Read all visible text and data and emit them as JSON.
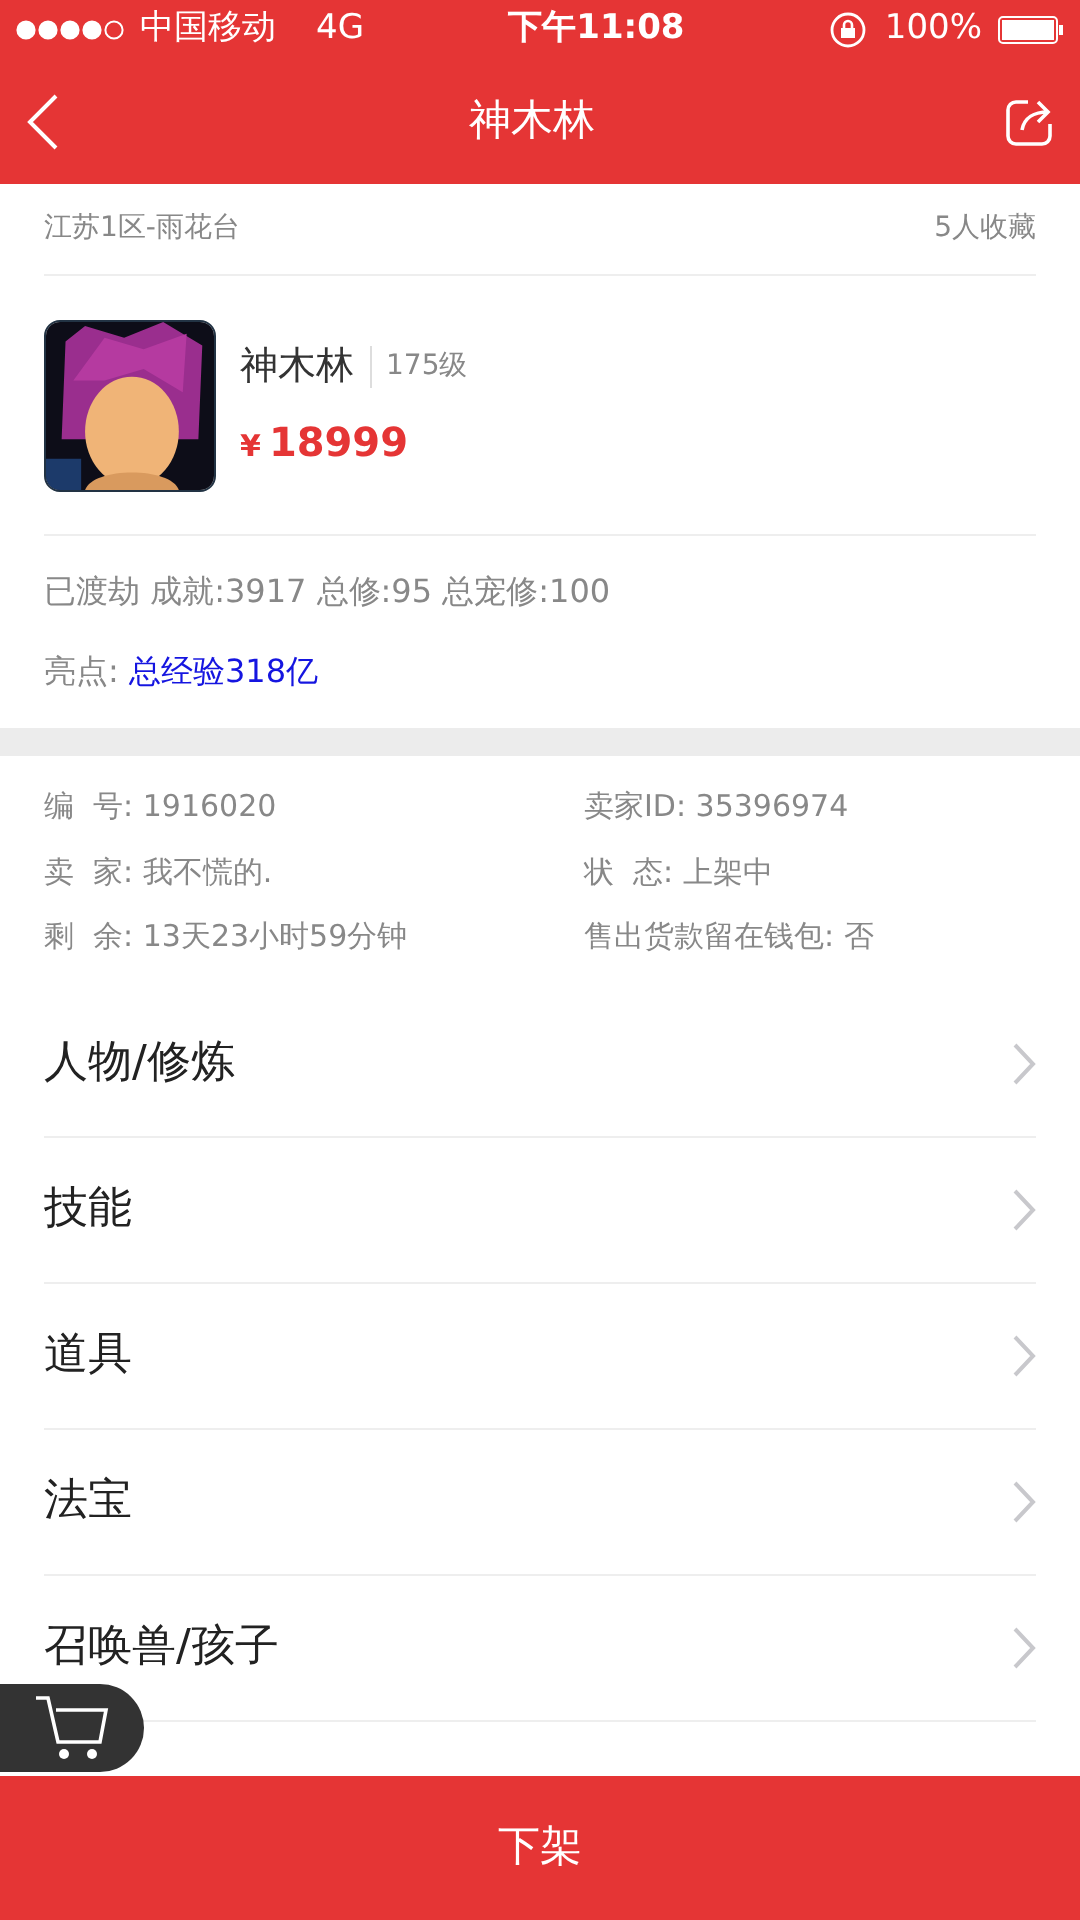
{
  "status_bar": {
    "carrier": "中国移动",
    "network": "4G",
    "time": "下午11:08",
    "battery": "100%"
  },
  "nav": {
    "title": "神木林"
  },
  "server": {
    "name": "江苏1区-雨花台",
    "favorites": "5人收藏"
  },
  "character": {
    "kind": "picture",
    "name": "神木林",
    "level": "175级",
    "price_symbol": "¥",
    "price": "18999"
  },
  "stats": "已渡劫 成就:3917 总修:95 总宠修:100",
  "highlight": {
    "label": "亮点:",
    "value": "总经验318亿"
  },
  "info": [
    {
      "text": "编  号: 1916020"
    },
    {
      "text": "卖家ID: 35396974"
    },
    {
      "text": "卖  家: 我不慌的."
    },
    {
      "text": "状  态: 上架中"
    },
    {
      "text": "剩  余: 13天23小时59分钟"
    },
    {
      "text": "售出货款留在钱包: 否"
    }
  ],
  "menu": [
    {
      "label": "人物/修炼"
    },
    {
      "label": "技能"
    },
    {
      "label": "道具"
    },
    {
      "label": "法宝"
    },
    {
      "label": "召唤兽/孩子"
    }
  ],
  "action_button": "下架"
}
